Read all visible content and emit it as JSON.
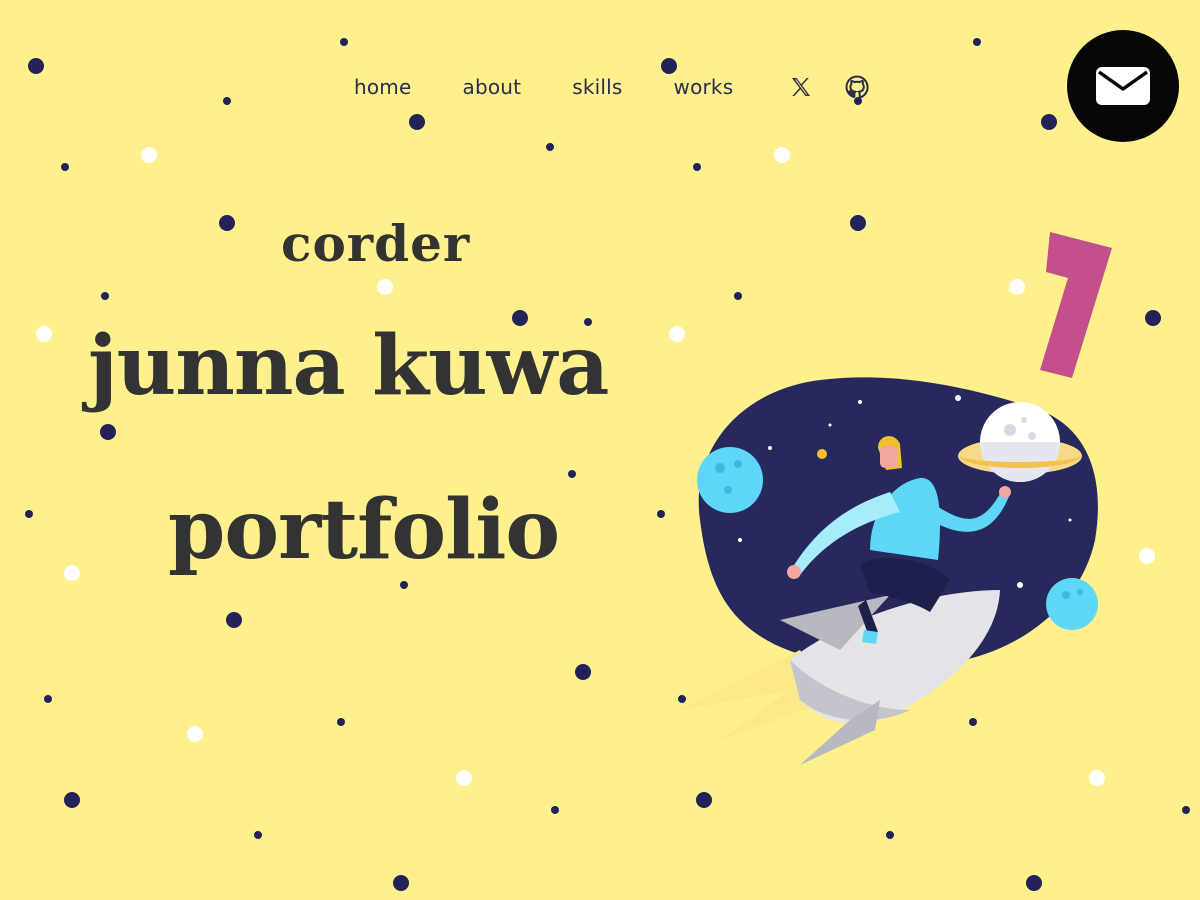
{
  "nav": {
    "items": [
      {
        "label": "home"
      },
      {
        "label": "about"
      },
      {
        "label": "skills"
      },
      {
        "label": "works"
      }
    ],
    "social": [
      "x-icon",
      "github-icon"
    ]
  },
  "mail": {
    "icon": "mail-icon"
  },
  "hero": {
    "subtitle": "corder",
    "name": "junna kuwa",
    "title": "portfolio"
  },
  "colors": {
    "background": "#fdf08d",
    "text": "#333333",
    "dot_dark": "#23235a",
    "dot_light": "#ffffff",
    "space": "#27285c",
    "accent_pink": "#c44f8c",
    "planet_blue": "#5ed6f7"
  },
  "illustration": "astronaut-riding-rocket-illustration"
}
